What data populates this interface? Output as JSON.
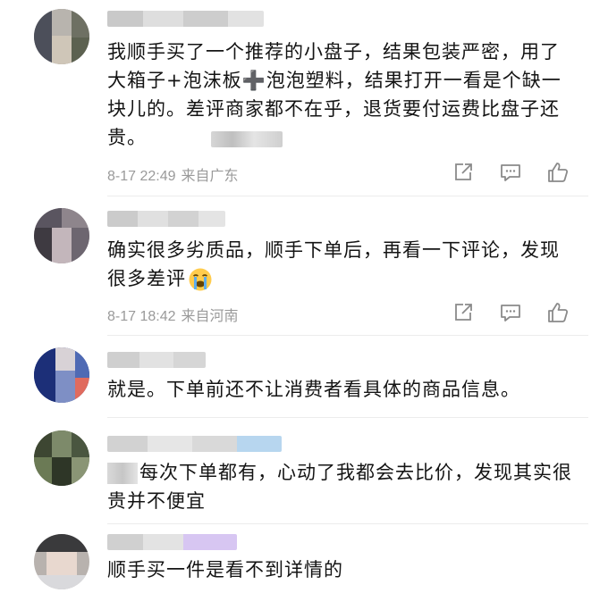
{
  "comments": [
    {
      "text": "我顺手买了一个推荐的小盘子，结果包装严密，用了大箱子+泡沫板➕泡泡塑料，结果打开一看是个缺一块儿的。差评商家都不在乎，退货要付运费比盘子还贵。",
      "time": "8-17 22:49",
      "location": "来自广东"
    },
    {
      "text": "确实很多劣质品，顺手下单后，再看一下评论，发现很多差评",
      "emoji": "loudly-crying-face",
      "time": "8-17 18:42",
      "location": "来自河南"
    },
    {
      "text": "就是。下单前还不让消费者看具体的商品信息。"
    },
    {
      "text": "每次下单都有，心动了我都会去比价，发现其实很贵并不便宜"
    },
    {
      "text": "顺手买一件是看不到详情的"
    }
  ],
  "icons": {
    "share": "share-icon",
    "reply": "comment-icon",
    "like": "thumbs-up-icon"
  },
  "colors": {
    "meta": "#9a9a9a",
    "text": "#141414",
    "divider": "#ececec",
    "icon": "#8a8a8a"
  }
}
